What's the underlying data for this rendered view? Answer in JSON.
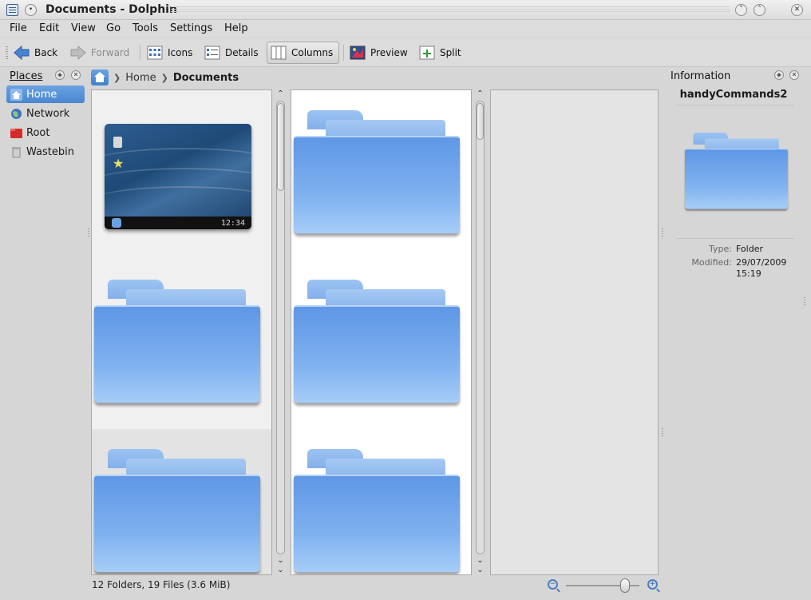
{
  "window": {
    "title": "Documents - Dolphin"
  },
  "menu": [
    "File",
    "Edit",
    "View",
    "Go",
    "Tools",
    "Settings",
    "Help"
  ],
  "toolbar": {
    "back": "Back",
    "forward": "Forward",
    "icons": "Icons",
    "details": "Details",
    "columns": "Columns",
    "preview": "Preview",
    "split": "Split"
  },
  "places": {
    "title": "Places",
    "items": [
      {
        "label": "Home",
        "icon": "home-icon",
        "selected": true
      },
      {
        "label": "Network",
        "icon": "network-icon"
      },
      {
        "label": "Root",
        "icon": "root-folder-icon"
      },
      {
        "label": "Wastebin",
        "icon": "trash-icon"
      }
    ]
  },
  "breadcrumb": {
    "items": [
      "Home",
      "Documents"
    ]
  },
  "preview_clock": "12:34",
  "info": {
    "title": "Information",
    "name": "handyCommands2",
    "type_label": "Type:",
    "type_value": "Folder",
    "modified_label": "Modified:",
    "modified_value": "29/07/2009",
    "modified_time": "15:19"
  },
  "status": {
    "text": "12 Folders, 19 Files (3.6 MiB)"
  },
  "zoom": {
    "level": 0.8
  },
  "colors": {
    "selection": "#4a86d0",
    "folder": "#6fa5ea"
  }
}
